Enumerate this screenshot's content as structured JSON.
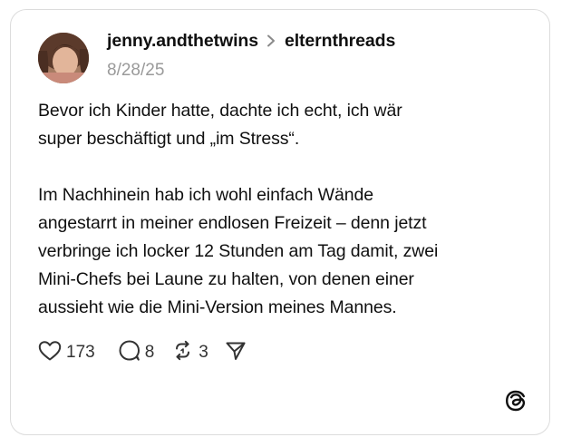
{
  "post": {
    "username": "jenny.andthetwins",
    "community": "elternthreads",
    "date": "8/28/25",
    "paragraph1": [
      "Bevor ich Kinder hatte, dachte ich echt, ich wär",
      "super beschäftigt und „im Stress“."
    ],
    "paragraph2": [
      "Im Nachhinein hab ich wohl einfach Wände",
      "angestarrt in meiner endlosen Freizeit – denn jetzt",
      "verbringe ich locker 12 Stunden am Tag damit, zwei",
      "Mini-Chefs bei Laune zu halten, von denen einer",
      "aussieht wie die Mini-Version meines Mannes."
    ]
  },
  "actions": {
    "likes": "173",
    "replies": "8",
    "reposts": "3"
  },
  "icons": {
    "like": "heart-icon",
    "reply": "speech-bubble-icon",
    "repost": "repost-icon",
    "share": "send-icon",
    "brand": "threads-logo-icon",
    "separator": "chevron-right-icon"
  },
  "colors": {
    "text": "#101010",
    "muted": "#9a9a9a",
    "border": "#dcdcdc"
  }
}
